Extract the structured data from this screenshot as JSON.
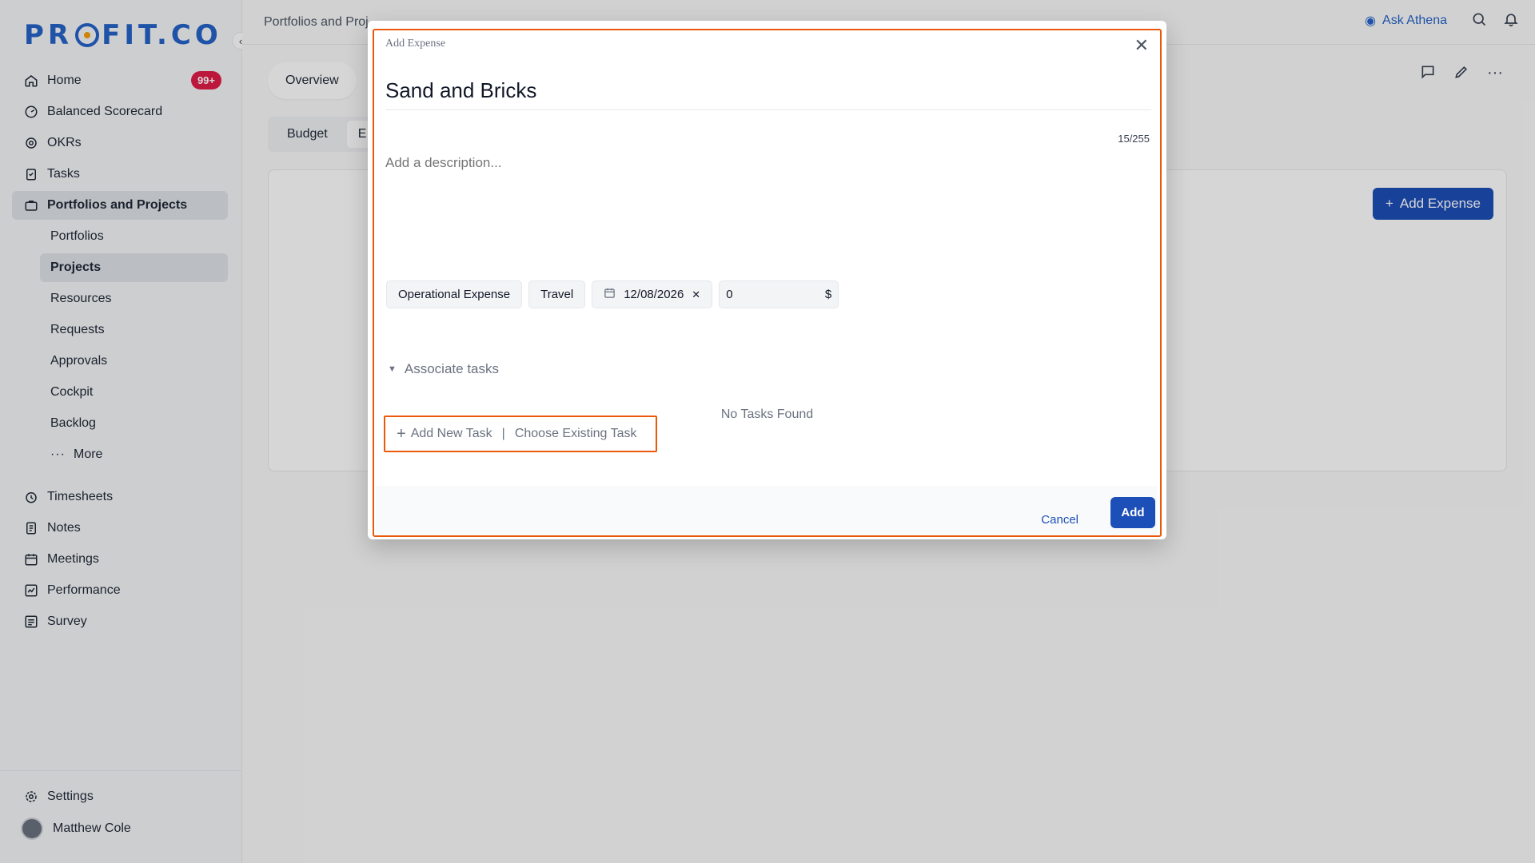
{
  "sidebar": {
    "logo_left": "PR",
    "logo_right": "FIT.CO",
    "nav": [
      {
        "label": "Home",
        "icon": "home-icon",
        "badge": "99+"
      },
      {
        "label": "Balanced Scorecard",
        "icon": "scorecard-icon"
      },
      {
        "label": "OKRs",
        "icon": "target-icon"
      },
      {
        "label": "Tasks",
        "icon": "clipboard-icon"
      },
      {
        "label": "Portfolios and Projects",
        "icon": "briefcase-icon"
      }
    ],
    "sub": [
      "Portfolios",
      "Projects",
      "Resources",
      "Requests",
      "Approvals",
      "Cockpit",
      "Backlog",
      "More"
    ],
    "nav2": [
      {
        "label": "Timesheets",
        "icon": "clock-icon"
      },
      {
        "label": "Notes",
        "icon": "notes-icon"
      },
      {
        "label": "Meetings",
        "icon": "calendar-icon"
      },
      {
        "label": "Performance",
        "icon": "chart-icon"
      },
      {
        "label": "Survey",
        "icon": "survey-icon"
      }
    ],
    "settings": "Settings",
    "user": "Matthew Cole"
  },
  "topbar": {
    "breadcrumb": "Portfolios and Proj",
    "ask": "Ask Athena"
  },
  "tabs": {
    "overview": "Overview"
  },
  "subtabs": {
    "budget": "Budget",
    "expense": "E"
  },
  "main": {
    "add_expense": "Add Expense"
  },
  "modal": {
    "title": "Add Expense",
    "name_value": "Sand and Bricks",
    "counter": "15/255",
    "desc_placeholder": "Add a description...",
    "type": "Operational Expense",
    "category": "Travel",
    "date": "12/08/2026",
    "amount": "0",
    "currency": "$",
    "associate": "Associate tasks",
    "no_tasks": "No Tasks Found",
    "add_new_task": "Add New Task",
    "separator": "|",
    "choose_existing": "Choose Existing Task",
    "cancel": "Cancel",
    "add": "Add"
  },
  "colors": {
    "accent": "#1d4fb8",
    "highlight": "#ea580c",
    "badge": "#e11d48"
  }
}
